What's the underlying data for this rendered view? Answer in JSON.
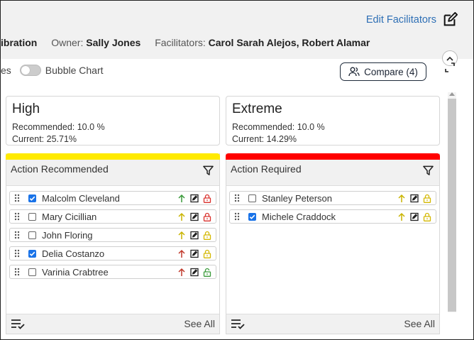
{
  "header": {
    "edit_facilitators": "Edit Facilitators",
    "cutoff_text": "ibration",
    "owner_label": "Owner:",
    "owner_value": "Sally Jones",
    "facilitators_label": "Facilitators:",
    "facilitators_value": "Carol Sarah Alejos, Robert Alamar"
  },
  "toolbar": {
    "cutoff_prefix": "es",
    "bubble_chart_label": "Bubble Chart",
    "bubble_chart_on": false,
    "compare_label": "Compare (4)"
  },
  "columns": [
    {
      "level": "High",
      "recommended": "Recommended: 10.0 %",
      "current": "Current: 25.71%",
      "lane_title": "Action Recommended",
      "lane_color": "#ffea00",
      "see_all": "See All",
      "items": [
        {
          "name": "Malcolm Cleveland",
          "checked": true,
          "arrow": "#3a9a3a",
          "lock": "#d9302c",
          "locked": true
        },
        {
          "name": "Mary Cicillian",
          "checked": false,
          "arrow": "#c9b400",
          "lock": "#d9302c",
          "locked": true
        },
        {
          "name": "John Floring",
          "checked": false,
          "arrow": "#c9b400",
          "lock": "#d4b800",
          "locked": true
        },
        {
          "name": "Delia Costanzo",
          "checked": true,
          "arrow": "#c0392b",
          "lock": "#d4b800",
          "locked": true
        },
        {
          "name": "Varinia Crabtree",
          "checked": false,
          "arrow": "#c0392b",
          "lock": "#3a9a3a",
          "locked": false
        }
      ]
    },
    {
      "level": "Extreme",
      "recommended": "Recommended: 10.0 %",
      "current": "Current: 14.29%",
      "lane_title": "Action Required",
      "lane_color": "#ff0000",
      "see_all": "See All",
      "items": [
        {
          "name": "Stanley Peterson",
          "checked": false,
          "arrow": "#c9b400",
          "lock": "#d4b800",
          "locked": true
        },
        {
          "name": "Michele Craddock",
          "checked": true,
          "arrow": "#c9b400",
          "lock": "#d4b800",
          "locked": true
        }
      ]
    }
  ]
}
